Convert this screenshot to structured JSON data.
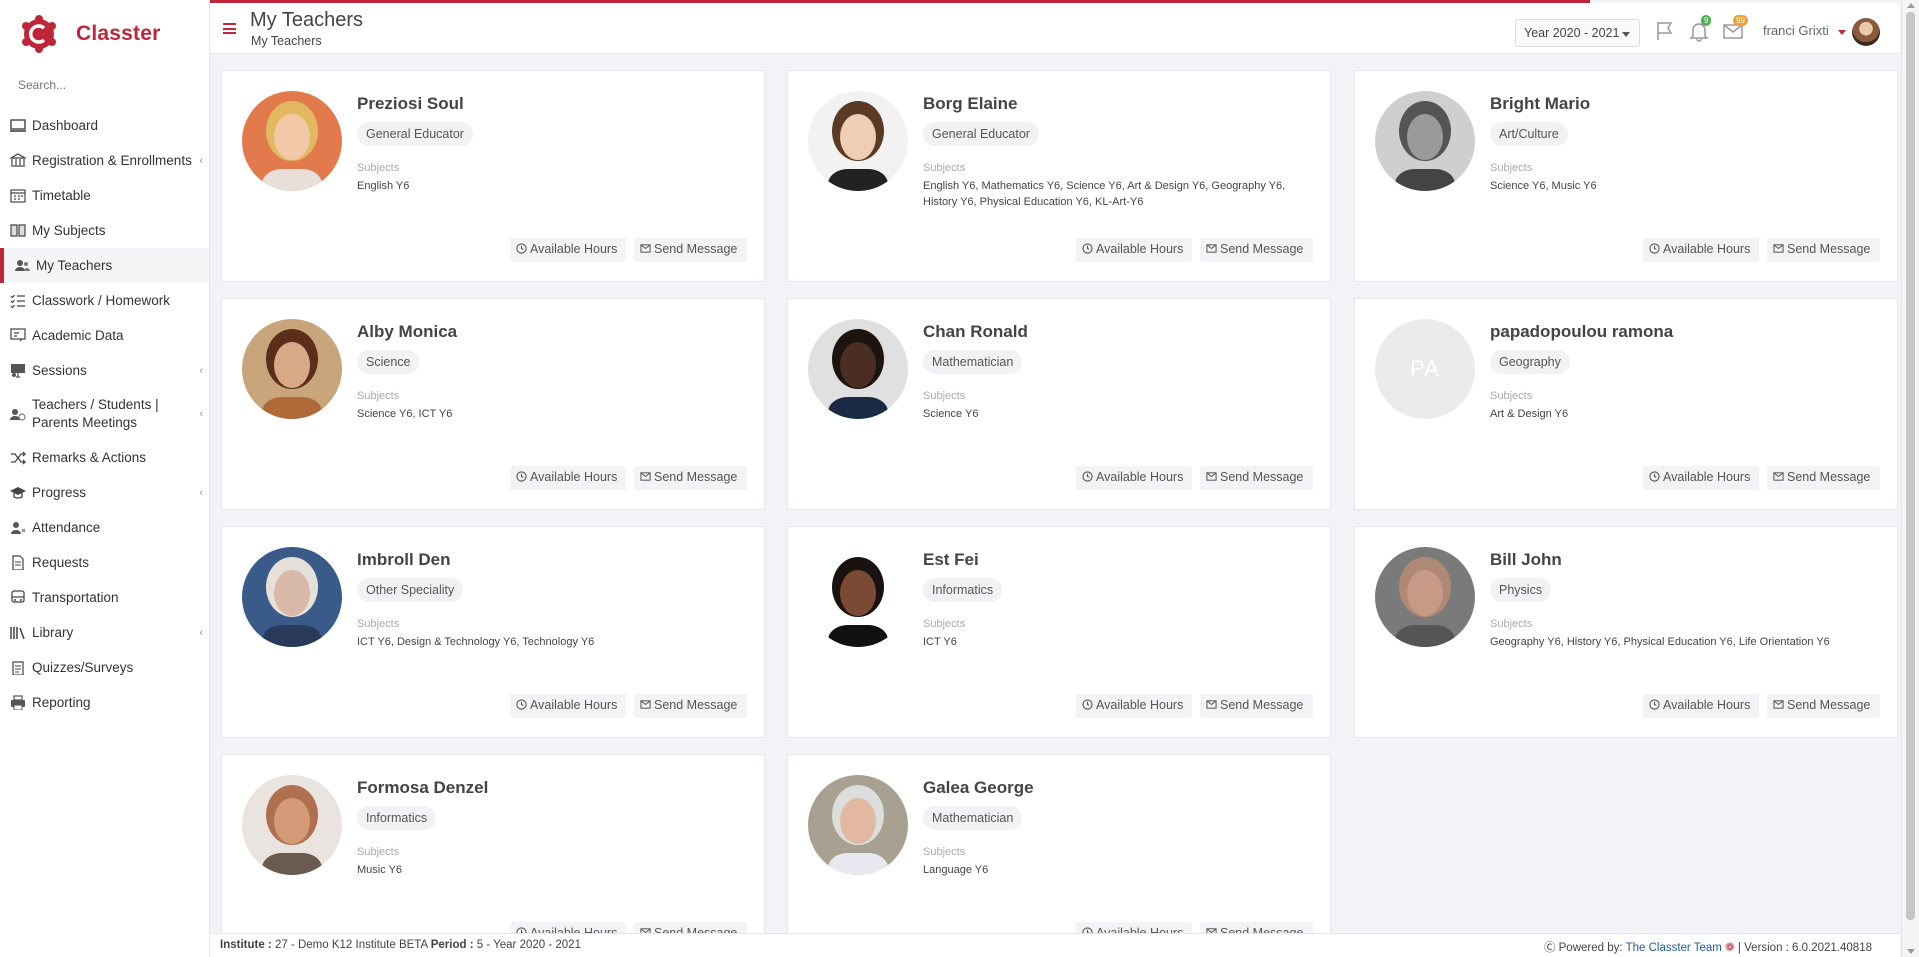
{
  "app": {
    "name": "Classter"
  },
  "search": {
    "placeholder": "Search..."
  },
  "sidebar": {
    "items": [
      {
        "label": "Dashboard",
        "icon": "monitor-icon",
        "chevron": false
      },
      {
        "label": "Registration & Enrollments",
        "icon": "bank-icon",
        "chevron": true
      },
      {
        "label": "Timetable",
        "icon": "calendar-icon",
        "chevron": false
      },
      {
        "label": "My Subjects",
        "icon": "book-icon",
        "chevron": false
      },
      {
        "label": "My Teachers",
        "icon": "users-icon",
        "chevron": false,
        "active": true
      },
      {
        "label": "Classwork / Homework",
        "icon": "checklist-icon",
        "chevron": false
      },
      {
        "label": "Academic Data",
        "icon": "chalkboard-icon",
        "chevron": false
      },
      {
        "label": "Sessions",
        "icon": "presentation-icon",
        "chevron": true
      },
      {
        "label": "Teachers / Students | Parents Meetings",
        "icon": "meeting-icon",
        "chevron": true
      },
      {
        "label": "Remarks & Actions",
        "icon": "shuffle-icon",
        "chevron": false
      },
      {
        "label": "Progress",
        "icon": "graduation-cap-icon",
        "chevron": true
      },
      {
        "label": "Attendance",
        "icon": "user-x-icon",
        "chevron": false
      },
      {
        "label": "Requests",
        "icon": "document-icon",
        "chevron": false
      },
      {
        "label": "Transportation",
        "icon": "bus-icon",
        "chevron": false
      },
      {
        "label": "Library",
        "icon": "library-icon",
        "chevron": true
      },
      {
        "label": "Quizzes/Surveys",
        "icon": "clipboard-icon",
        "chevron": false
      },
      {
        "label": "Reporting",
        "icon": "printer-icon",
        "chevron": false
      }
    ]
  },
  "header": {
    "title": "My Teachers",
    "breadcrumb": "My Teachers",
    "year": "Year 2020 - 2021",
    "notifications_count": "9",
    "messages_count": "99",
    "user_name": "franci Grixti"
  },
  "buttons": {
    "hours": "Available Hours",
    "message": "Send Message"
  },
  "subjects_label": "Subjects",
  "teachers": [
    {
      "name": "Preziosi Soul",
      "speciality": "General Educator",
      "subjects": "English Y6",
      "photo": "woman-blonde"
    },
    {
      "name": "Borg Elaine",
      "speciality": "General Educator",
      "subjects": "English Y6, Mathematics Y6, Science Y6, Art & Design Y6, Geography Y6, History Y6, Physical Education Y6, KL-Art-Y6",
      "photo": "woman-brown"
    },
    {
      "name": "Bright Mario",
      "speciality": "Art/Culture",
      "subjects": "Science Y6, Music Y6",
      "photo": "man-bw"
    },
    {
      "name": "Alby Monica",
      "speciality": "Science",
      "subjects": "Science Y6, ICT Y6",
      "photo": "woman-curly"
    },
    {
      "name": "Chan Ronald",
      "speciality": "Mathematician",
      "subjects": "Science Y6",
      "photo": "man-suit"
    },
    {
      "name": "papadopoulou ramona",
      "speciality": "Geography",
      "subjects": "Art & Design Y6",
      "photo": "initials",
      "initials": "PA"
    },
    {
      "name": "Imbroll Den",
      "speciality": "Other Speciality",
      "subjects": "ICT Y6, Design & Technology Y6, Technology Y6",
      "photo": "man-old"
    },
    {
      "name": "Est Fei",
      "speciality": "Informatics",
      "subjects": "ICT Y6",
      "photo": "woman-standing"
    },
    {
      "name": "Bill John",
      "speciality": "Physics",
      "subjects": "Geography Y6, History Y6, Physical Education Y6, Life Orientation Y6",
      "photo": "man-bald"
    },
    {
      "name": "Formosa Denzel",
      "speciality": "Informatics",
      "subjects": "Music Y6",
      "photo": "man-face"
    },
    {
      "name": "Galea George",
      "speciality": "Mathematician",
      "subjects": "Language Y6",
      "photo": "man-desk"
    }
  ],
  "footer": {
    "institute_label": "Institute :",
    "institute_value": "27 - Demo K12 Institute BETA",
    "period_label": "Period :",
    "period_value": "5 - Year 2020 - 2021",
    "powered_label": "Powered by:",
    "powered_link": "The Classter Team",
    "version": "| Version : 6.0.2021.40818"
  },
  "colors": {
    "accent": "#c0263a",
    "link": "#1f5a96",
    "badge_green": "#4caf50",
    "badge_orange": "#f0a030"
  }
}
